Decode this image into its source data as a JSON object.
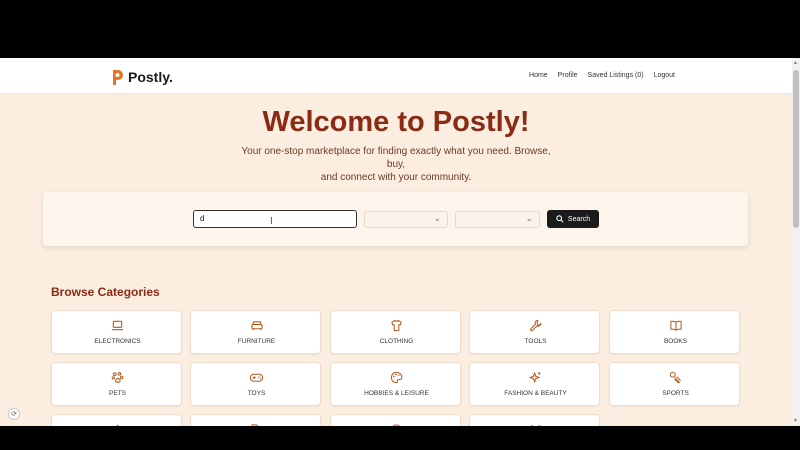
{
  "brand": {
    "name": "Postly.",
    "accent": "#e8731e",
    "title_color": "#8a2b15"
  },
  "nav": {
    "home": "Home",
    "profile": "Profile",
    "saved": "Saved Listings (0)",
    "logout": "Logout"
  },
  "hero": {
    "title": "Welcome to Postly!",
    "subtitle_line1": "Your one-stop marketplace for finding exactly what you need. Browse, buy,",
    "subtitle_line2": "and connect with your community."
  },
  "search": {
    "query": "d",
    "category_select": "",
    "location_select": "",
    "button_label": "Search"
  },
  "categories": {
    "title": "Browse Categories",
    "items": [
      {
        "label": "ELECTRONICS",
        "icon": "laptop-icon"
      },
      {
        "label": "FURNITURE",
        "icon": "sofa-icon"
      },
      {
        "label": "CLOTHING",
        "icon": "shirt-icon"
      },
      {
        "label": "TOOLS",
        "icon": "wrench-icon"
      },
      {
        "label": "BOOKS",
        "icon": "book-icon"
      },
      {
        "label": "PETS",
        "icon": "paw-icon"
      },
      {
        "label": "TOYS",
        "icon": "gamepad-icon"
      },
      {
        "label": "HOBBIES & LEISURE",
        "icon": "palette-icon"
      },
      {
        "label": "FASHION & BEAUTY",
        "icon": "sparkles-icon"
      },
      {
        "label": "SPORTS",
        "icon": "sports-icon"
      }
    ]
  }
}
